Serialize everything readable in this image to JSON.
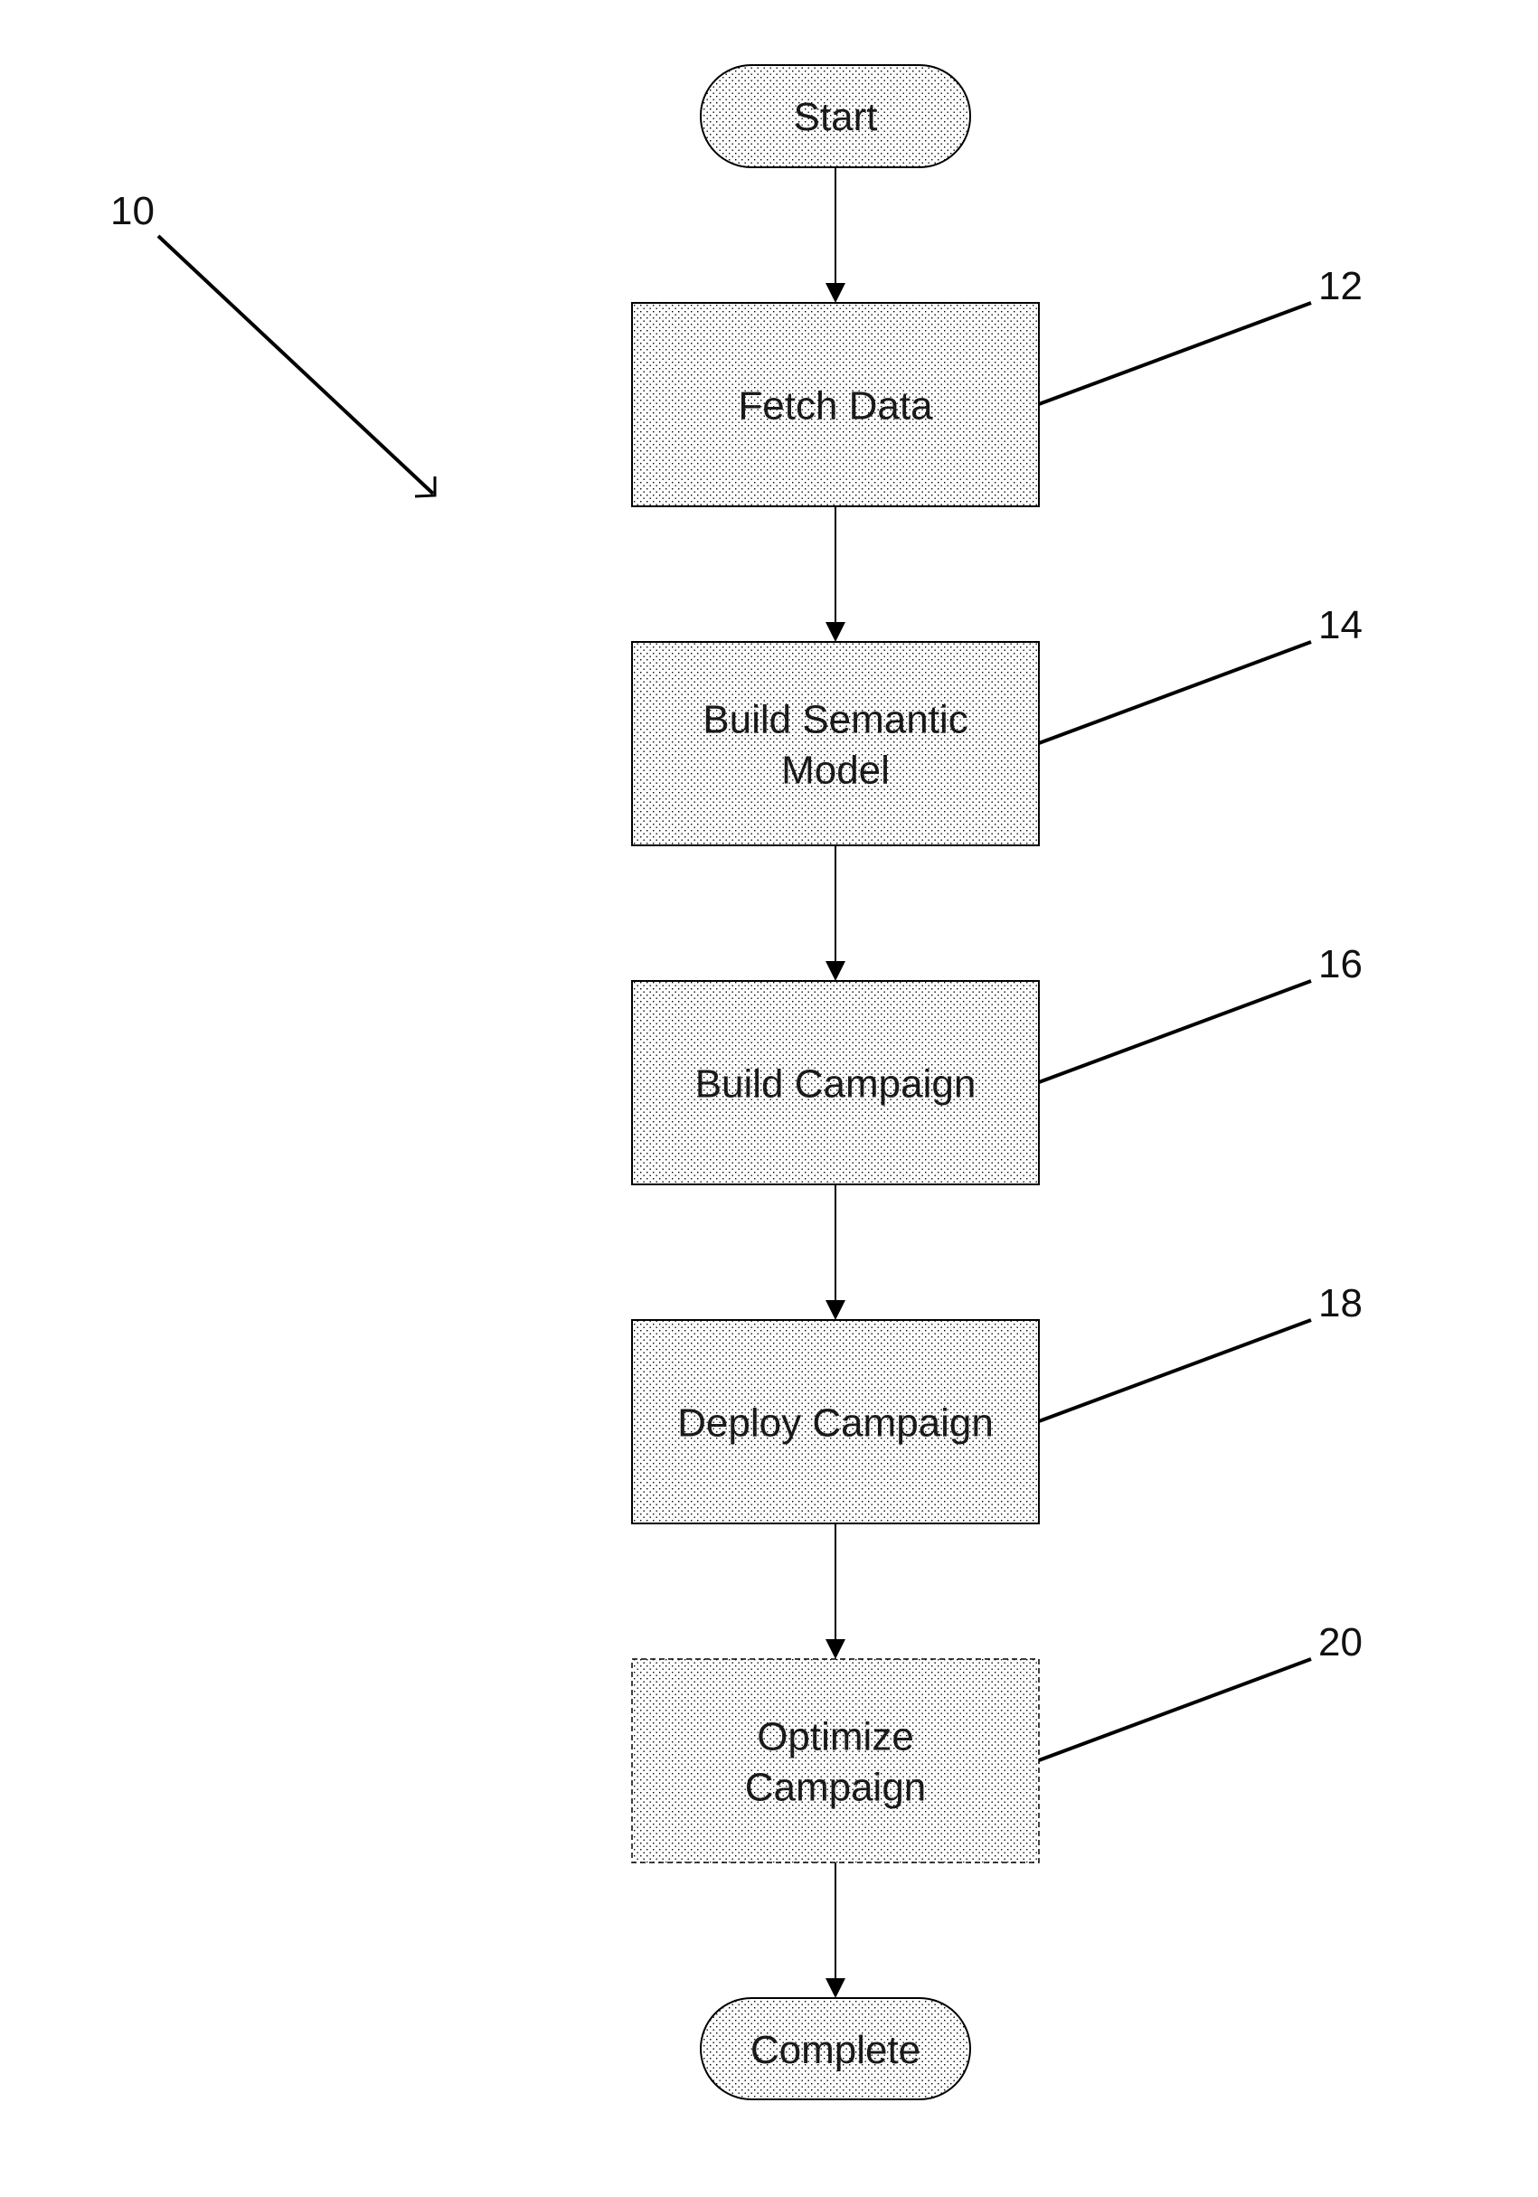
{
  "diagram": {
    "type": "flowchart",
    "figure_ref": "10",
    "start": {
      "label": "Start"
    },
    "end": {
      "label": "Complete"
    },
    "steps": [
      {
        "id": "fetch-data",
        "lines": [
          "Fetch Data"
        ],
        "ref": "12",
        "optional": false
      },
      {
        "id": "build-semantic-model",
        "lines": [
          "Build Semantic",
          "Model"
        ],
        "ref": "14",
        "optional": false
      },
      {
        "id": "build-campaign",
        "lines": [
          "Build Campaign"
        ],
        "ref": "16",
        "optional": false
      },
      {
        "id": "deploy-campaign",
        "lines": [
          "Deploy Campaign"
        ],
        "ref": "18",
        "optional": false
      },
      {
        "id": "optimize-campaign",
        "lines": [
          "Optimize",
          "Campaign"
        ],
        "ref": "20",
        "optional": true
      }
    ],
    "colors": {
      "stroke": "#000000",
      "fill_dots": "#000000",
      "background": "#ffffff"
    }
  }
}
